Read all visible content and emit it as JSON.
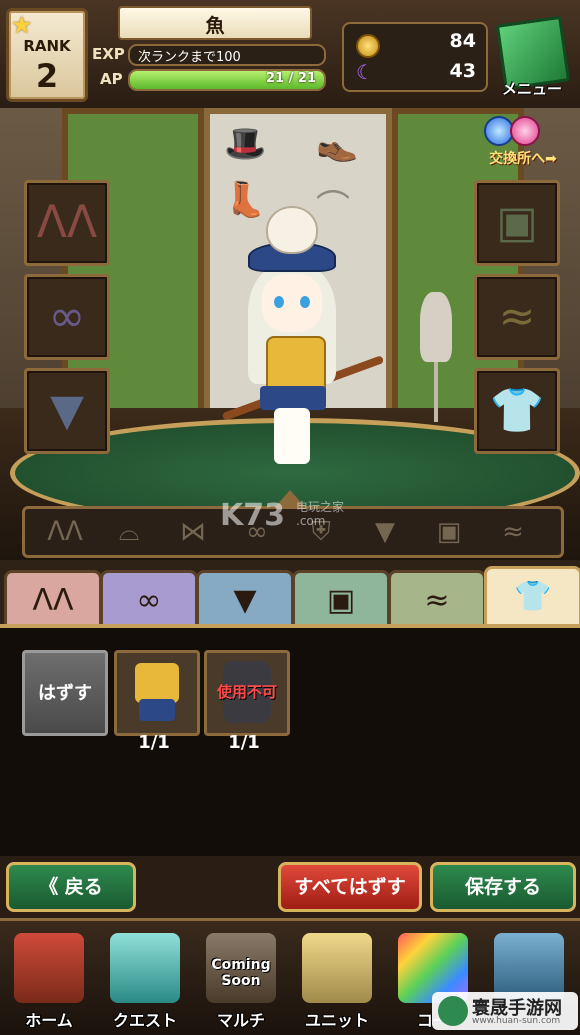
{
  "header": {
    "rank_label": "RANK",
    "rank_value": "2",
    "player_name": "魚",
    "exp_label": "EXP",
    "exp_text": "次ランクまで100",
    "ap_label": "AP",
    "ap_text": "21 / 21",
    "ap_fraction": 1.0,
    "coins": "84",
    "moons": "43",
    "menu_label": "メニュー",
    "exchange_label": "交換所へ➡"
  },
  "stage": {
    "left_slots": [
      "rabbit-ears",
      "glasses",
      "necktie"
    ],
    "right_slots": [
      "backpack",
      "tail",
      "outfit"
    ],
    "strip_icons": [
      "rabbit-ears",
      "hat",
      "ribbon",
      "glasses",
      "armor",
      "necktie",
      "backpack",
      "tail"
    ]
  },
  "tabs": [
    {
      "name": "ears",
      "color": "#d9a7a0"
    },
    {
      "name": "glasses",
      "color": "#a89bd0"
    },
    {
      "name": "necktie",
      "color": "#86a9c4"
    },
    {
      "name": "bag",
      "color": "#8fb59a"
    },
    {
      "name": "tail",
      "color": "#a7b58a"
    },
    {
      "name": "outfit",
      "color": "#f6e7c4",
      "selected": true
    }
  ],
  "items": {
    "remove_label": "はずす",
    "list": [
      {
        "count": "1/1",
        "unusable": false
      },
      {
        "count": "1/1",
        "unusable": true,
        "unusable_label": "使用不可"
      }
    ]
  },
  "actions": {
    "back_label": "《 戻る",
    "unequip_all_label": "すべてはずす",
    "save_label": "保存する"
  },
  "nav": {
    "items": [
      {
        "label": "ホーム"
      },
      {
        "label": "クエスト"
      },
      {
        "label": "マルチ",
        "badge": "Coming Soon"
      },
      {
        "label": "ユニット"
      },
      {
        "label": "コー"
      },
      {
        "label": ""
      }
    ]
  },
  "watermarks": {
    "center": "K73",
    "center_sub": "电玩之家\n.com",
    "corner": "寰晟手游网",
    "corner_url": "www.huan-sun.com"
  },
  "colors": {
    "ap_bar": "#5cb82a",
    "accent_gold": "#d8b45c",
    "green_button": "#2e8a4e",
    "red_button": "#e04a3a"
  }
}
